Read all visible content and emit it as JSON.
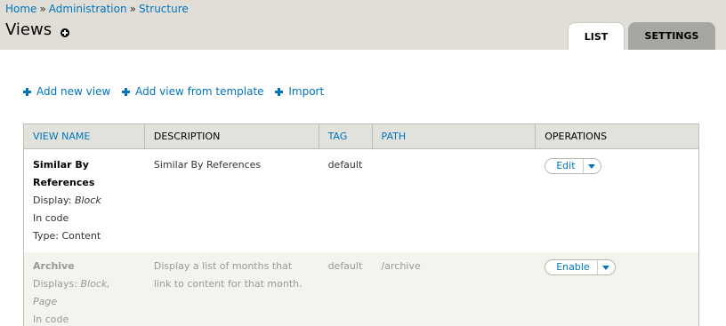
{
  "breadcrumb": {
    "items": [
      "Home",
      "Administration",
      "Structure"
    ],
    "separator": "»"
  },
  "page_title": "Views",
  "tabs": [
    {
      "label": "List",
      "active": true
    },
    {
      "label": "Settings",
      "active": false
    }
  ],
  "actions": [
    "Add new view",
    "Add view from template",
    "Import"
  ],
  "table": {
    "headers": [
      "View name",
      "Description",
      "Tag",
      "Path",
      "Operations"
    ],
    "rows": [
      {
        "name": "Similar By References",
        "display_label": "Display:",
        "display_value": "Block",
        "storage": "In code",
        "type_label": "Type:",
        "type_value": "Content",
        "description": "Similar By References",
        "tag": "default",
        "path": "",
        "operation": "Edit"
      },
      {
        "name": "Archive",
        "display_label": "Displays:",
        "display_value": "Block, Page",
        "storage": "In code",
        "description": "Display a list of months that link to content for that month.",
        "tag": "default",
        "path": "/archive",
        "operation": "Enable"
      }
    ]
  },
  "colors": {
    "link": "#0074bd",
    "header_bg": "#e0ded6",
    "disabled_row_bg": "#f3f4ee"
  }
}
